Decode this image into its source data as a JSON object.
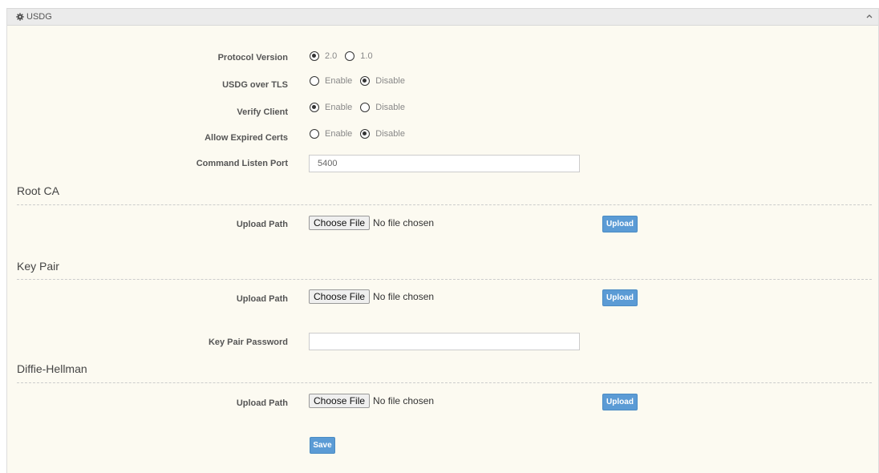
{
  "panel": {
    "title": "USDG"
  },
  "form": {
    "protocol_version": {
      "label": "Protocol Version",
      "options": [
        "2.0",
        "1.0"
      ],
      "selected": "2.0"
    },
    "usdg_over_tls": {
      "label": "USDG over TLS",
      "options": [
        "Enable",
        "Disable"
      ],
      "selected": "Disable"
    },
    "verify_client": {
      "label": "Verify Client",
      "options": [
        "Enable",
        "Disable"
      ],
      "selected": "Enable"
    },
    "allow_expired_certs": {
      "label": "Allow Expired Certs",
      "options": [
        "Enable",
        "Disable"
      ],
      "selected": "Disable"
    },
    "command_listen_port": {
      "label": "Command Listen Port",
      "value": "5400"
    }
  },
  "root_ca": {
    "title": "Root CA",
    "upload_label": "Upload Path",
    "choose_file": "Choose File",
    "no_file": "No file chosen",
    "upload_button": "Upload"
  },
  "key_pair": {
    "title": "Key Pair",
    "upload_label": "Upload Path",
    "choose_file": "Choose File",
    "no_file": "No file chosen",
    "upload_button": "Upload",
    "password_label": "Key Pair Password",
    "password_value": ""
  },
  "diffie_hellman": {
    "title": "Diffie-Hellman",
    "upload_label": "Upload Path",
    "choose_file": "Choose File",
    "no_file": "No file chosen",
    "upload_button": "Upload"
  },
  "save_button": "Save",
  "colors": {
    "button_blue": "#5b9bd5",
    "panel_bg": "#fcfaf1"
  }
}
